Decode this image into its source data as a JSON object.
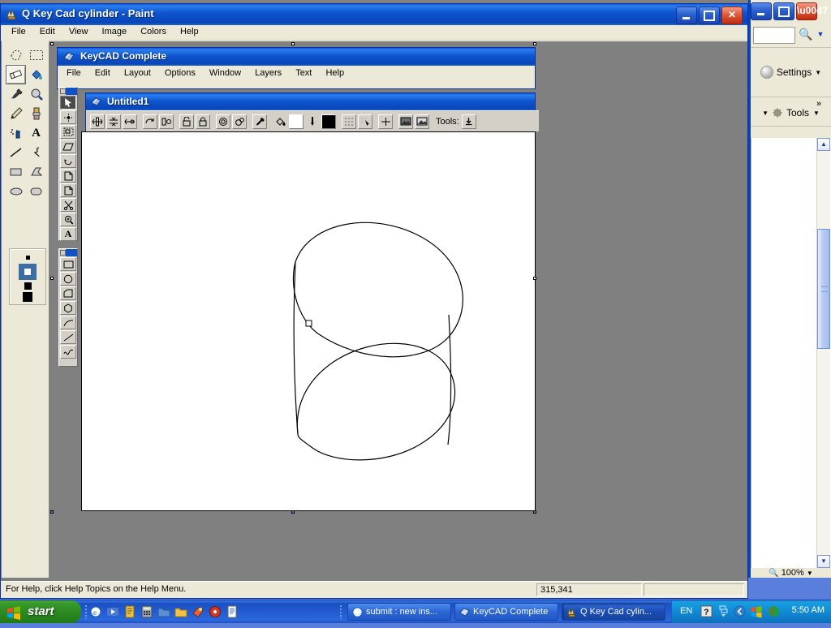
{
  "paint": {
    "title": "Q Key Cad cylinder - Paint",
    "icon": "paint-icon",
    "menu": [
      "File",
      "Edit",
      "View",
      "Image",
      "Colors",
      "Help"
    ],
    "window_buttons": [
      "minimize",
      "maximize",
      "close"
    ],
    "status_hint": "For Help, click Help Topics on the Help Menu.",
    "status_coords": "315,341",
    "status_size": "",
    "tools": [
      {
        "name": "free-form-select",
        "glyph": "✦",
        "selected": false
      },
      {
        "name": "rectangle-select",
        "glyph": "⬚",
        "selected": false
      },
      {
        "name": "eraser",
        "glyph": "eraser",
        "selected": true
      },
      {
        "name": "fill-with-color",
        "glyph": "bucket",
        "selected": false
      },
      {
        "name": "pick-color",
        "glyph": "dropper",
        "selected": false
      },
      {
        "name": "magnifier",
        "glyph": "magnifier",
        "selected": false
      },
      {
        "name": "pencil",
        "glyph": "pencil",
        "selected": false
      },
      {
        "name": "brush",
        "glyph": "brush",
        "selected": false
      },
      {
        "name": "airbrush",
        "glyph": "airbrush",
        "selected": false
      },
      {
        "name": "text",
        "glyph": "A",
        "selected": false
      },
      {
        "name": "line",
        "glyph": "line",
        "selected": false
      },
      {
        "name": "curve",
        "glyph": "curve",
        "selected": false
      },
      {
        "name": "rectangle",
        "glyph": "rect",
        "selected": false
      },
      {
        "name": "polygon",
        "glyph": "poly",
        "selected": false
      },
      {
        "name": "ellipse",
        "glyph": "ellipse",
        "selected": false
      },
      {
        "name": "rounded-rectangle",
        "glyph": "roundrect",
        "selected": false
      }
    ],
    "eraser_sizes": [
      4,
      7,
      9,
      12
    ],
    "eraser_selected_index": 1
  },
  "keycad": {
    "title": "KeyCAD Complete",
    "menu": [
      "File",
      "Edit",
      "Layout",
      "Options",
      "Window",
      "Layers",
      "Text",
      "Help"
    ],
    "child_window": {
      "title": "Untitled1",
      "toolbar_tools_label": "Tools:",
      "toolbar_buttons": [
        "mirror-horizontal",
        "flip-vertical",
        "mirror-vertical",
        "rotate-left",
        "rotate-around-point",
        "lock-open",
        "lock-closed",
        "group",
        "ungroup",
        "eyedropper",
        "fill-bucket",
        "fill-color-swatch",
        "pen",
        "line-color-swatch",
        "grid-toggle",
        "snap-toggle",
        "crosshair",
        "image-dark",
        "image-light"
      ],
      "fill_color": "#ffffff",
      "line_color": "#000000"
    },
    "palette_tools": [
      "arrow-select",
      "node-edit",
      "marquee-select",
      "skew",
      "rotate",
      "trim-corner",
      "page-corner",
      "scissors",
      "zoom",
      "text"
    ],
    "palette_shapes": [
      "rectangle",
      "circle",
      "polygon",
      "hexagon",
      "arc",
      "line",
      "wave"
    ]
  },
  "background_window": {
    "search_value": "",
    "settings_label": "Settings",
    "tools_label": "Tools",
    "zoom_label": "100%",
    "chevron": "»"
  },
  "drawing": {
    "description": "tilted 3D cylinder outline",
    "stroke_color": "#000000",
    "background": "#ffffff"
  },
  "taskbar": {
    "start_label": "start",
    "quick_launch": [
      "internet-explorer-icon",
      "media-icon",
      "notes-icon",
      "calculator-icon",
      "folder-blue-icon",
      "folder-yellow-icon",
      "paint-shop-icon",
      "record-icon",
      "document-icon"
    ],
    "buttons": [
      {
        "label": "submit : new ins...",
        "icon": "internet-explorer-icon",
        "active": false
      },
      {
        "label": "KeyCAD Complete",
        "icon": "keycad-icon",
        "active": false
      },
      {
        "label": "Q Key Cad cylin...",
        "icon": "paint-icon",
        "active": true
      }
    ],
    "tray": {
      "language": "EN",
      "icons": [
        "help-icon",
        "network-icon",
        "show-hidden-chevron-icon",
        "security-center-icon",
        "antivirus-icon"
      ],
      "time": "5:50 AM"
    }
  }
}
